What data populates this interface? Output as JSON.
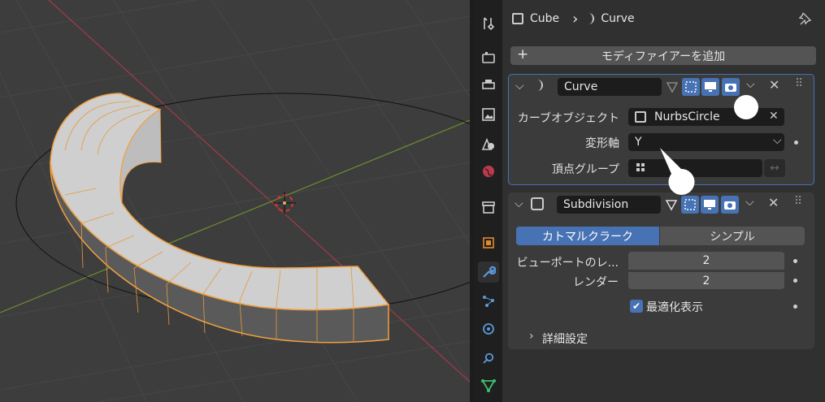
{
  "breadcrumb": {
    "object": "Cube",
    "separator": "›",
    "data": "Curve"
  },
  "add_modifier": {
    "plus": "+",
    "label": "モディファイアーを追加"
  },
  "curve_modifier": {
    "name": "Curve",
    "curve_object_label": "カーブオブジェクト",
    "curve_object_value": "NurbsCircle",
    "deform_axis_label": "変形軸",
    "deform_axis_value": "Y",
    "vertex_group_label": "頂点グループ"
  },
  "subdiv_modifier": {
    "name": "Subdivision",
    "type_catmull": "カトマルクラーク",
    "type_simple": "シンプル",
    "viewport_label": "ビューポートのレ...",
    "viewport_value": "2",
    "render_label": "レンダー",
    "render_value": "2",
    "optimal_label": "最適化表示",
    "advanced_label": "詳細設定"
  },
  "colors": {
    "accent": "#4772b3",
    "viewport_bg": "#3d3d3d",
    "selection_orange": "#f0a040"
  },
  "icons": [
    "tool-icon",
    "render-icon",
    "output-icon",
    "view-layer-icon",
    "scene-icon",
    "world-icon",
    "collection-icon",
    "object-icon",
    "modifier-wrench-icon",
    "particles-icon",
    "physics-icon",
    "constraints-icon",
    "data-icon"
  ]
}
